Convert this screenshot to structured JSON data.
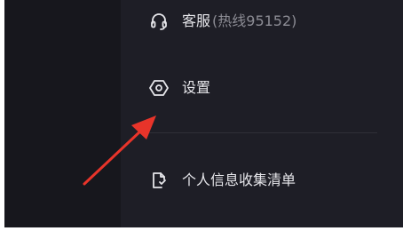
{
  "menu": {
    "support": {
      "label": "客服",
      "sub": "(热线95152)",
      "icon": "headset-icon"
    },
    "settings": {
      "label": "设置",
      "icon": "hexagon-settings-icon"
    },
    "privacy": {
      "label": "个人信息收集清单",
      "icon": "document-list-icon"
    }
  },
  "colors": {
    "panel_bg": "#1e1e26",
    "dimmed_bg": "#17171d",
    "text": "#e6e6ea",
    "subtext": "#8c8c94",
    "annotation_arrow": "#e8342a"
  }
}
